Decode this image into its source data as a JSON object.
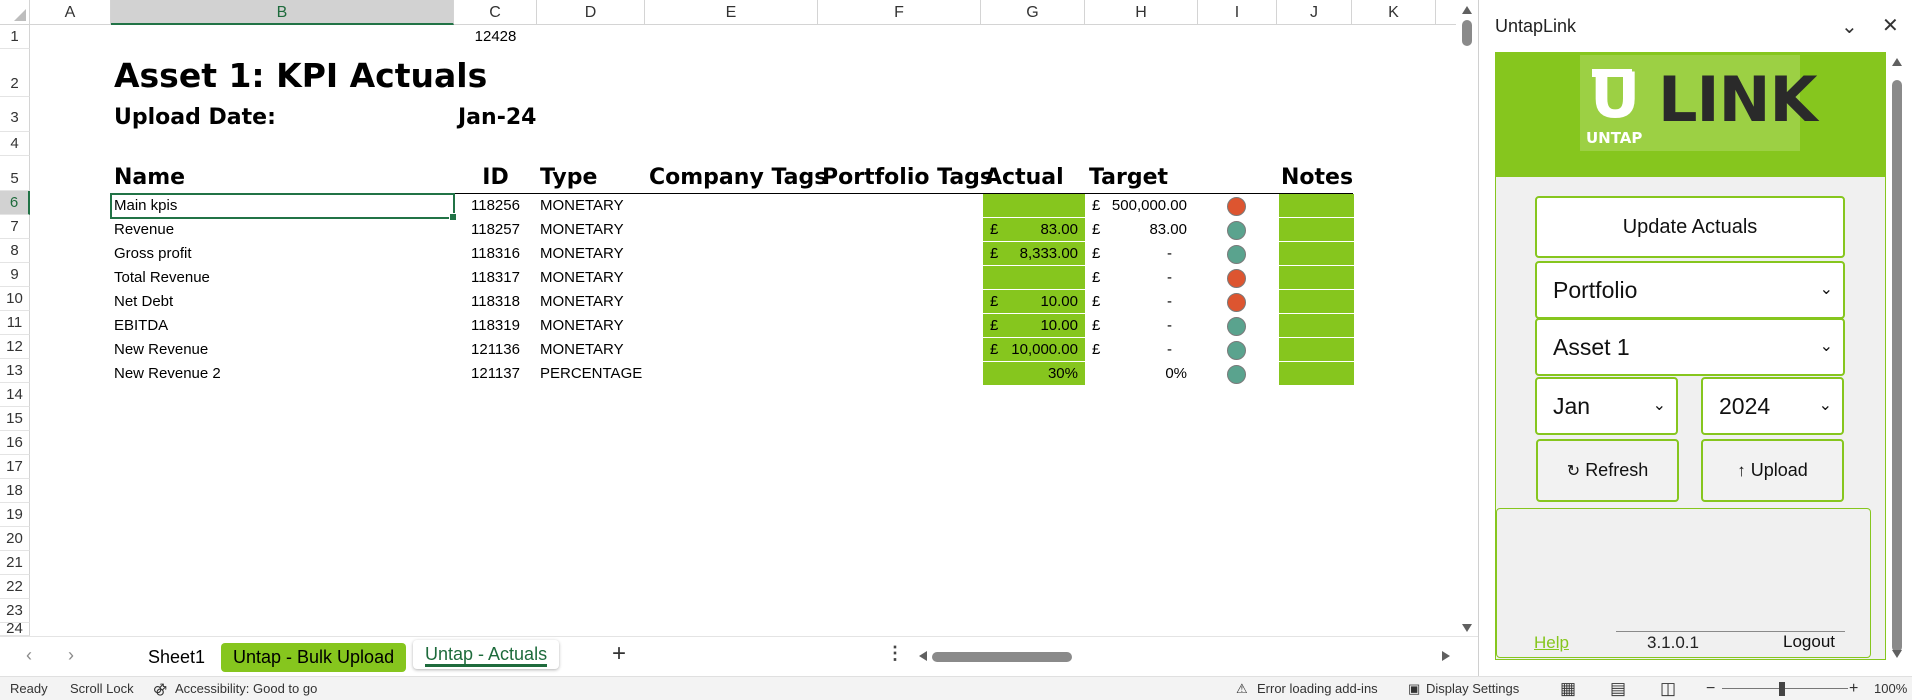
{
  "columns": [
    "A",
    "B",
    "C",
    "D",
    "E",
    "F",
    "G",
    "H",
    "I",
    "J",
    "K"
  ],
  "rows": [
    "1",
    "2",
    "3",
    "4",
    "5",
    "6",
    "7",
    "8",
    "9",
    "10",
    "11",
    "12",
    "13",
    "14",
    "15",
    "16",
    "17",
    "18",
    "19",
    "20",
    "21",
    "22",
    "23",
    "24"
  ],
  "cells": {
    "c1": "12428",
    "title": "Asset 1: KPI Actuals",
    "upload_label": "Upload Date:",
    "upload_value": "Jan-24"
  },
  "headers": {
    "name": "Name",
    "id": "ID",
    "type": "Type",
    "company_tags": "Company Tags",
    "portfolio_tags": "Portfolio Tags",
    "actual": "Actual",
    "target": "Target",
    "notes": "Notes"
  },
  "kpis": [
    {
      "name": "Main kpis",
      "id": "118256",
      "type": "MONETARY",
      "actual_sym": "",
      "actual": "",
      "target_sym": "£",
      "target": "500,000.00",
      "status": "red"
    },
    {
      "name": "Revenue",
      "id": "118257",
      "type": "MONETARY",
      "actual_sym": "£",
      "actual": "83.00",
      "target_sym": "£",
      "target": "83.00",
      "status": "teal"
    },
    {
      "name": "Gross profit",
      "id": "118316",
      "type": "MONETARY",
      "actual_sym": "£",
      "actual": "8,333.00",
      "target_sym": "£",
      "target": "-",
      "status": "teal"
    },
    {
      "name": "Total Revenue",
      "id": "118317",
      "type": "MONETARY",
      "actual_sym": "",
      "actual": "",
      "target_sym": "£",
      "target": "-",
      "status": "red"
    },
    {
      "name": "Net Debt",
      "id": "118318",
      "type": "MONETARY",
      "actual_sym": "£",
      "actual": "10.00",
      "target_sym": "£",
      "target": "-",
      "status": "red"
    },
    {
      "name": "EBITDA",
      "id": "118319",
      "type": "MONETARY",
      "actual_sym": "£",
      "actual": "10.00",
      "target_sym": "£",
      "target": "-",
      "status": "teal"
    },
    {
      "name": "New Revenue",
      "id": "121136",
      "type": "MONETARY",
      "actual_sym": "£",
      "actual": "10,000.00",
      "target_sym": "£",
      "target": "-",
      "status": "teal"
    },
    {
      "name": "New Revenue 2",
      "id": "121137",
      "type": "PERCENTAGE",
      "actual_sym": "",
      "actual": "30%",
      "target_sym": "",
      "target": "0%",
      "status": "teal"
    }
  ],
  "tabs": {
    "sheet1": "Sheet1",
    "bulk": "Untap - Bulk Upload",
    "actuals": "Untap - Actuals",
    "add": "+"
  },
  "status_bar": {
    "ready": "Ready",
    "scroll_lock": "Scroll Lock",
    "accessibility": "Accessibility: Good to go",
    "addins": "Error loading add-ins",
    "display": "Display Settings",
    "zoom": "100%"
  },
  "pane": {
    "title": "UntapLink",
    "logo_mark": "U",
    "logo_text": "LINK",
    "logo_sub": "UNTAP",
    "update_button": "Update Actuals",
    "portfolio_select": "Portfolio",
    "asset_select": "Asset 1",
    "month_select": "Jan",
    "year_select": "2024",
    "refresh_button": "Refresh",
    "upload_button": "Upload",
    "help_link": "Help",
    "version": "3.1.0.1",
    "logout": "Logout"
  },
  "colors": {
    "accent_green": "#86c61e",
    "excel_green": "#217346",
    "status_red": "#dd5530",
    "status_teal": "#5aa38e"
  }
}
